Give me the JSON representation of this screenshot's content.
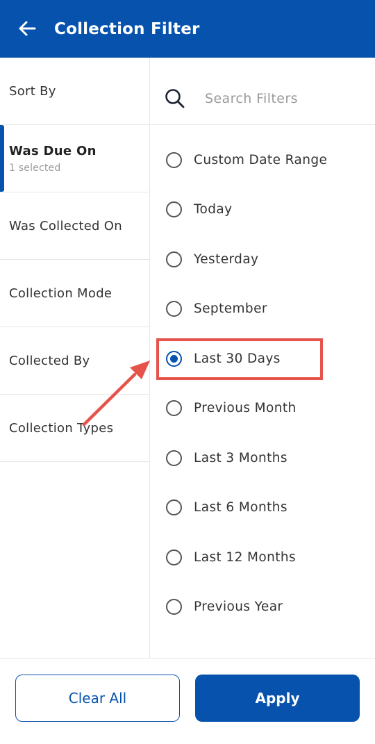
{
  "header": {
    "title": "Collection Filter"
  },
  "sidebar": {
    "items": [
      {
        "label": "Sort By",
        "sub": ""
      },
      {
        "label": "Was Due On",
        "sub": "1 selected"
      },
      {
        "label": "Was Collected On",
        "sub": ""
      },
      {
        "label": "Collection Mode",
        "sub": ""
      },
      {
        "label": "Collected By",
        "sub": ""
      },
      {
        "label": "Collection Types",
        "sub": ""
      }
    ],
    "active_index": 1
  },
  "search": {
    "placeholder": "Search Filters"
  },
  "options": [
    {
      "label": "Custom Date Range",
      "selected": false
    },
    {
      "label": "Today",
      "selected": false
    },
    {
      "label": "Yesterday",
      "selected": false
    },
    {
      "label": "September",
      "selected": false
    },
    {
      "label": "Last 30 Days",
      "selected": true
    },
    {
      "label": "Previous Month",
      "selected": false
    },
    {
      "label": "Last 3 Months",
      "selected": false
    },
    {
      "label": "Last 6 Months",
      "selected": false
    },
    {
      "label": "Last 12 Months",
      "selected": false
    },
    {
      "label": "Previous Year",
      "selected": false
    }
  ],
  "footer": {
    "clear_label": "Clear All",
    "apply_label": "Apply"
  },
  "colors": {
    "primary": "#0652AC",
    "annotation": "#E5534B"
  },
  "icons": {
    "back": "arrow-left-icon",
    "search": "search-icon",
    "annotation": "red-arrow-icon"
  }
}
